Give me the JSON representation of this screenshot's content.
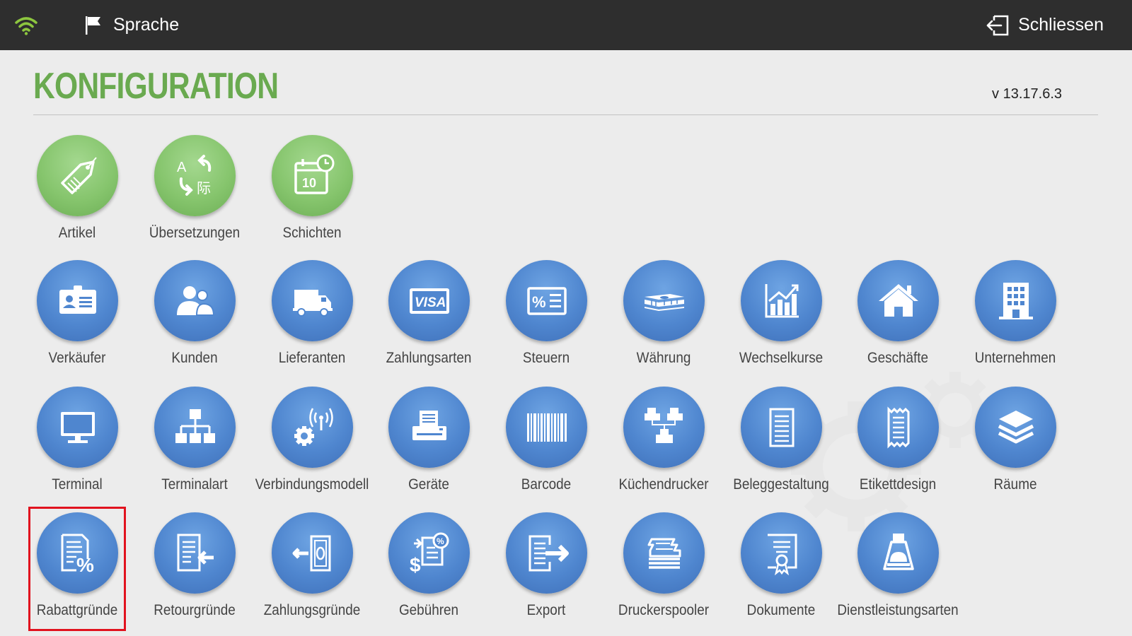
{
  "topbar": {
    "language_label": "Sprache",
    "close_label": "Schliessen"
  },
  "header": {
    "title": "KONFIGURATION",
    "version": "v 13.17.6.3"
  },
  "colors": {
    "title": "#6aaa50",
    "green_tile": "#86c56d",
    "blue_tile": "#4f86cf",
    "topbar": "#2e2e2e",
    "selection": "#e1121e"
  },
  "tiles": {
    "artikel": "Artikel",
    "uebersetzungen": "Übersetzungen",
    "schichten": "Schichten",
    "verkaeufer": "Verkäufer",
    "kunden": "Kunden",
    "lieferanten": "Lieferanten",
    "zahlungsarten": "Zahlungsarten",
    "steuern": "Steuern",
    "waehrung": "Währung",
    "wechselkurse": "Wechselkurse",
    "geschaefte": "Geschäfte",
    "unternehmen": "Unternehmen",
    "terminal": "Terminal",
    "terminalart": "Terminalart",
    "verbindungsmodell": "Verbindungsmodell",
    "geraete": "Geräte",
    "barcode": "Barcode",
    "kuechendrucker": "Küchendrucker",
    "beleggestaltung": "Beleggestaltung",
    "etikettdesign": "Etikettdesign",
    "raeume": "Räume",
    "rabattgruende": "Rabattgründe",
    "retourgruende": "Retourgründe",
    "zahlungsgruende": "Zahlungsgründe",
    "gebuehren": "Gebühren",
    "export": "Export",
    "druckerspooler": "Druckerspooler",
    "dokumente": "Dokumente",
    "dienstleistungsarten": "Dienstleistungsarten"
  },
  "icons": {
    "artikel": "price-tag-icon",
    "uebersetzungen": "translate-icon",
    "schichten": "calendar-clock-icon",
    "verkaeufer": "id-card-icon",
    "kunden": "users-icon",
    "lieferanten": "truck-icon",
    "zahlungsarten": "credit-card-icon",
    "steuern": "tax-percent-icon",
    "waehrung": "money-stack-icon",
    "wechselkurse": "chart-icon",
    "geschaefte": "house-icon",
    "unternehmen": "building-icon",
    "terminal": "monitor-icon",
    "terminalart": "network-tree-icon",
    "verbindungsmodell": "antenna-gear-icon",
    "geraete": "printer-icon",
    "barcode": "barcode-icon",
    "kuechendrucker": "printers-icon",
    "beleggestaltung": "receipt-icon",
    "etikettdesign": "label-icon",
    "raeume": "layers-icon",
    "rabattgruende": "discount-document-icon",
    "retourgruende": "return-document-icon",
    "zahlungsgruende": "payment-out-icon",
    "gebuehren": "fee-icon",
    "export": "export-icon",
    "druckerspooler": "paper-stack-icon",
    "dokumente": "certificate-icon",
    "dienstleistungsarten": "service-bell-icon"
  },
  "selected_tile": "rabattgruende"
}
